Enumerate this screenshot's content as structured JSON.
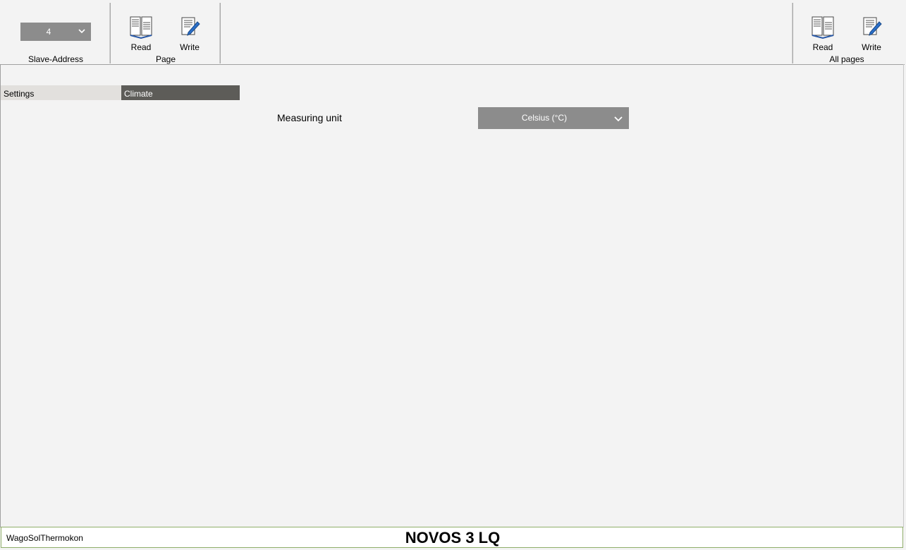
{
  "ribbon": {
    "slave_address": {
      "value": "4",
      "label": "Slave-Address"
    },
    "page_group": {
      "label": "Page",
      "read_label": "Read",
      "write_label": "Write"
    },
    "all_pages_group": {
      "label": "All pages",
      "read_label": "Read",
      "write_label": "Write"
    }
  },
  "tabs": [
    {
      "label": "Settings",
      "active": false
    },
    {
      "label": "Climate",
      "active": true
    }
  ],
  "climate": {
    "measuring_unit": {
      "label": "Measuring unit",
      "value": "Celsius (°C)"
    }
  },
  "status": {
    "vendor": "WagoSolThermokon",
    "device": "NOVOS 3 LQ"
  },
  "colors": {
    "active_tab": "#5d5c58",
    "inactive_tab": "#e2e0dd",
    "select_bg": "#8c8c8c",
    "statusbar_border": "#8fae6a"
  },
  "icons": {
    "read": "book-read-icon",
    "write": "pencil-write-icon",
    "dropdown": "chevron-down-icon"
  }
}
